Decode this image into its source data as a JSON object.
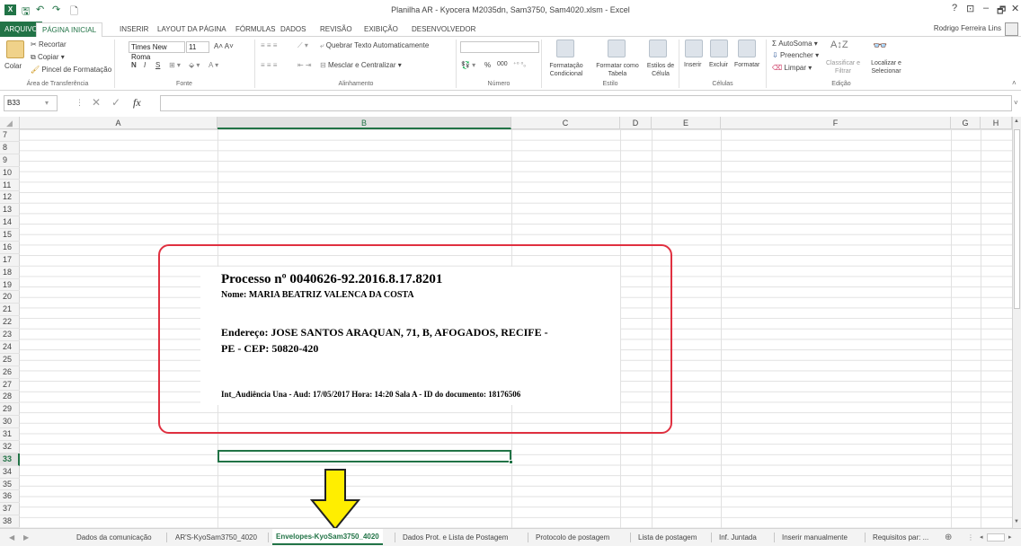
{
  "window": {
    "title": "Planilha AR - Kyocera M2035dn, Sam3750, Sam4020.xlsm - Excel",
    "user": "Rodrigo Ferreira Lins",
    "help": "?",
    "minimize": "–",
    "restore": "🗗",
    "close": "✕"
  },
  "tabs": [
    "ARQUIVO",
    "PÁGINA INICIAL",
    "INSERIR",
    "LAYOUT DA PÁGINA",
    "FÓRMULAS",
    "DADOS",
    "REVISÃO",
    "EXIBIÇÃO",
    "DESENVOLVEDOR"
  ],
  "ribbon": {
    "clipboard": {
      "paste": "Colar",
      "cut": "Recortar",
      "copy": "Copiar",
      "format_painter": "Pincel de Formatação",
      "label": "Área de Transferência"
    },
    "font": {
      "name": "Times New Roma",
      "size": "11",
      "bold": "N",
      "italic": "I",
      "underline": "S",
      "label": "Fonte"
    },
    "alignment": {
      "wrap": "Quebrar Texto Automaticamente",
      "merge": "Mesclar e Centralizar",
      "label": "Alinhamento"
    },
    "number": {
      "format": "",
      "percent": "%",
      "thousands": "000",
      "label": "Número"
    },
    "styles": {
      "conditional": "Formatação Condicional",
      "table": "Formatar como Tabela",
      "cell": "Estilos de Célula",
      "label": "Estilo"
    },
    "cells": {
      "insert": "Inserir",
      "delete": "Excluir",
      "format": "Formatar",
      "label": "Células"
    },
    "editing": {
      "autosum": "AutoSoma",
      "fill": "Preencher",
      "clear": "Limpar",
      "sort": "Classificar e Filtrar",
      "find": "Localizar e Selecionar",
      "label": "Edição"
    }
  },
  "formula_bar": {
    "name_box": "B33",
    "value": ""
  },
  "columns": [
    "A",
    "B",
    "C",
    "D",
    "E",
    "F",
    "G",
    "H"
  ],
  "rows": [
    "7",
    "8",
    "9",
    "10",
    "11",
    "12",
    "13",
    "14",
    "15",
    "16",
    "17",
    "18",
    "19",
    "20",
    "21",
    "22",
    "23",
    "24",
    "25",
    "26",
    "27",
    "28",
    "29",
    "30",
    "31",
    "32",
    "33",
    "34",
    "35",
    "36",
    "37",
    "38"
  ],
  "selected_row": "33",
  "selected_column": "B",
  "envelope": {
    "process": "Processo nº 0040626-92.2016.8.17.8201",
    "name": "Nome: MARIA BEATRIZ VALENCA DA COSTA",
    "address_line1": "Endereço: JOSE SANTOS ARAQUAN, 71, B, AFOGADOS, RECIFE -",
    "address_line2": "PE - CEP: 50820-420",
    "hearing": "Int_Audiência Una - Aud: 17/05/2017 Hora: 14:20 Sala A - ID do documento: 18176506"
  },
  "sheets": [
    "Dados da comunicação",
    "AR'S-KyoSam3750_4020",
    "Envelopes-KyoSam3750_4020",
    "Dados Prot. e Lista de Postagem",
    "Protocolo de postagem",
    "Lista de postagem",
    "Inf. Juntada",
    "Inserir manualmente",
    "Requisitos par: ..."
  ],
  "active_sheet": "Envelopes-KyoSam3750_4020",
  "colors": {
    "excel_green": "#217346",
    "highlight_red": "#e03040",
    "arrow_yellow": "#ffee00"
  }
}
